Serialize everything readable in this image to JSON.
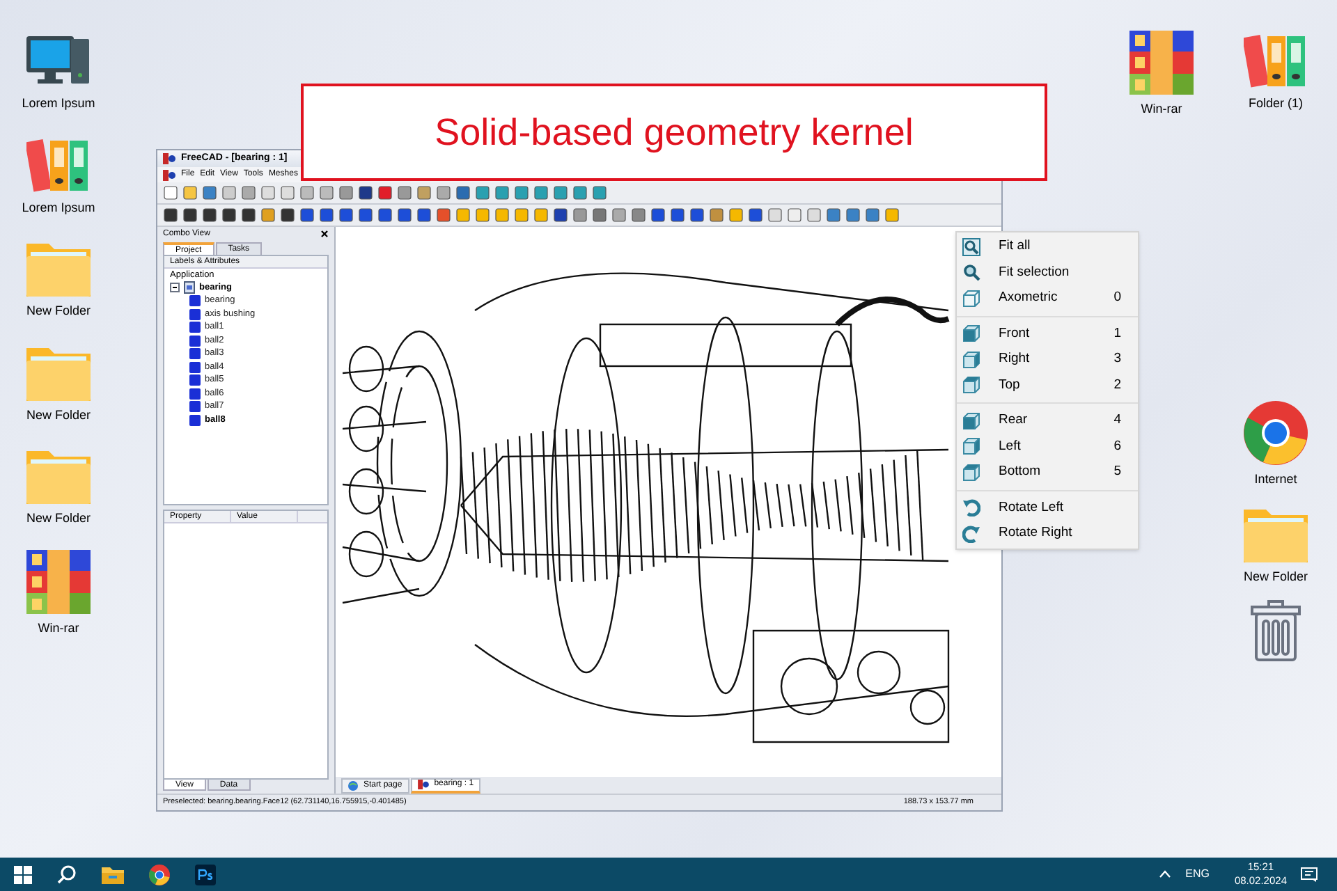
{
  "desktop": {
    "left_icons": [
      {
        "kind": "computer",
        "label": "Lorem Ipsum"
      },
      {
        "kind": "binders",
        "label": "Lorem Ipsum"
      },
      {
        "kind": "folder",
        "label": "New Folder"
      },
      {
        "kind": "folder",
        "label": "New Folder"
      },
      {
        "kind": "folder",
        "label": "New Folder"
      },
      {
        "kind": "archive",
        "label": "Win-rar"
      }
    ],
    "top_right_icons": [
      {
        "kind": "archive",
        "label": "Win-rar"
      },
      {
        "kind": "binders",
        "label": "Folder (1)"
      }
    ],
    "right_icons": [
      {
        "kind": "browser",
        "label": "Internet"
      },
      {
        "kind": "folder",
        "label": "New Folder"
      },
      {
        "kind": "trash"
      }
    ]
  },
  "banner": {
    "text": "Solid-based geometry kernel"
  },
  "window": {
    "title": "FreeCAD - [bearing : 1]",
    "menu": [
      "File",
      "Edit",
      "View",
      "Tools",
      "Meshes"
    ],
    "combo_view": {
      "title": "Combo View",
      "tabs": [
        {
          "label": "Project",
          "selected": true
        },
        {
          "label": "Tasks",
          "selected": false
        }
      ],
      "tree_header": "Labels & Attributes",
      "tree_root": "Application",
      "tree": [
        {
          "label": "bearing",
          "expanded": true,
          "children": [
            {
              "label": "bearing",
              "selected": false
            },
            {
              "label": "axis bushing",
              "selected": false
            },
            {
              "label": "ball1",
              "selected": false
            },
            {
              "label": "ball2",
              "selected": false
            },
            {
              "label": "ball3",
              "selected": false
            },
            {
              "label": "ball4",
              "selected": false
            },
            {
              "label": "ball5",
              "selected": false
            },
            {
              "label": "ball6",
              "selected": false
            },
            {
              "label": "ball7",
              "selected": false
            },
            {
              "label": "ball8",
              "selected": true
            }
          ]
        }
      ],
      "property_columns": [
        "Property",
        "Value"
      ],
      "bottom_tabs": [
        {
          "label": "View",
          "selected": true
        },
        {
          "label": "Data",
          "selected": false
        }
      ]
    },
    "doc_tabs": [
      {
        "kind": "web",
        "label": "Start page",
        "selected": false
      },
      {
        "kind": "doc",
        "label": "bearing : 1",
        "selected": true
      }
    ],
    "status_bar": {
      "message": "Preselected: bearing.bearing.Face12 (62.731140,16.755915,-0.401485)",
      "dimensions": "188.73 x 153.77 mm"
    }
  },
  "view_menu": {
    "sections": [
      [
        {
          "kind": "fit-all",
          "label": "Fit all"
        },
        {
          "kind": "fit-selection",
          "label": "Fit selection"
        },
        {
          "kind": "axometric",
          "label": "Axometric",
          "shortcut": "0"
        }
      ],
      [
        {
          "kind": "front",
          "label": "Front",
          "shortcut": "1"
        },
        {
          "kind": "right",
          "label": "Right",
          "shortcut": "3"
        },
        {
          "kind": "top",
          "label": "Top",
          "shortcut": "2"
        }
      ],
      [
        {
          "kind": "rear",
          "label": "Rear",
          "shortcut": "4"
        },
        {
          "kind": "left",
          "label": "Left",
          "shortcut": "6"
        },
        {
          "kind": "bottom",
          "label": "Bottom",
          "shortcut": "5"
        }
      ],
      [
        {
          "kind": "rotate-left",
          "label": "Rotate Left"
        },
        {
          "kind": "rotate-right",
          "label": "Rotate Right"
        }
      ]
    ]
  },
  "taskbar": {
    "language": "ENG",
    "time": "15:21",
    "date": "08.02.2024"
  }
}
